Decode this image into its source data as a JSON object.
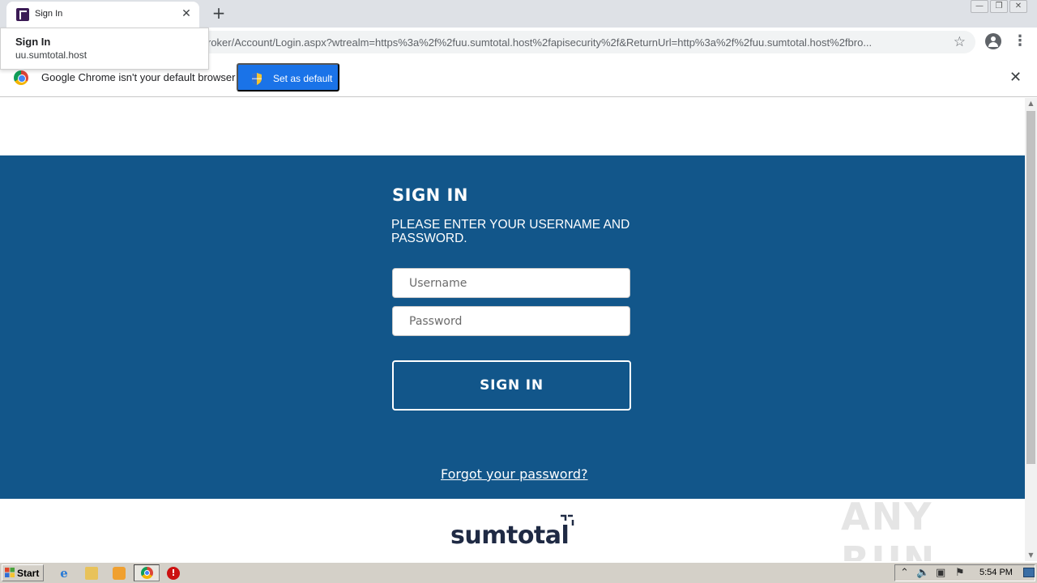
{
  "browser": {
    "tab_title": "Sign In",
    "url": "roker/Account/Login.aspx?wtrealm=https%3a%2f%2fuu.sumtotal.host%2fapisecurity%2f&ReturnUrl=http%3a%2f%2fuu.sumtotal.host%2fbro...",
    "tooltip": {
      "title": "Sign In",
      "host": "uu.sumtotal.host"
    },
    "infobar": {
      "message": "Google Chrome isn't your default browser",
      "button_label": "Set as default"
    }
  },
  "login": {
    "heading": "SIGN IN",
    "subheading": "PLEASE ENTER YOUR USERNAME AND PASSWORD.",
    "username_placeholder": "Username",
    "password_placeholder": "Password",
    "signin_button": "SIGN IN",
    "forgot_link": "Forgot your password?",
    "logo_text": "sumtotal",
    "accent_color": "#12568a"
  },
  "watermark": "ANY RUN",
  "taskbar": {
    "start_label": "Start",
    "clock": "5:54 PM"
  }
}
